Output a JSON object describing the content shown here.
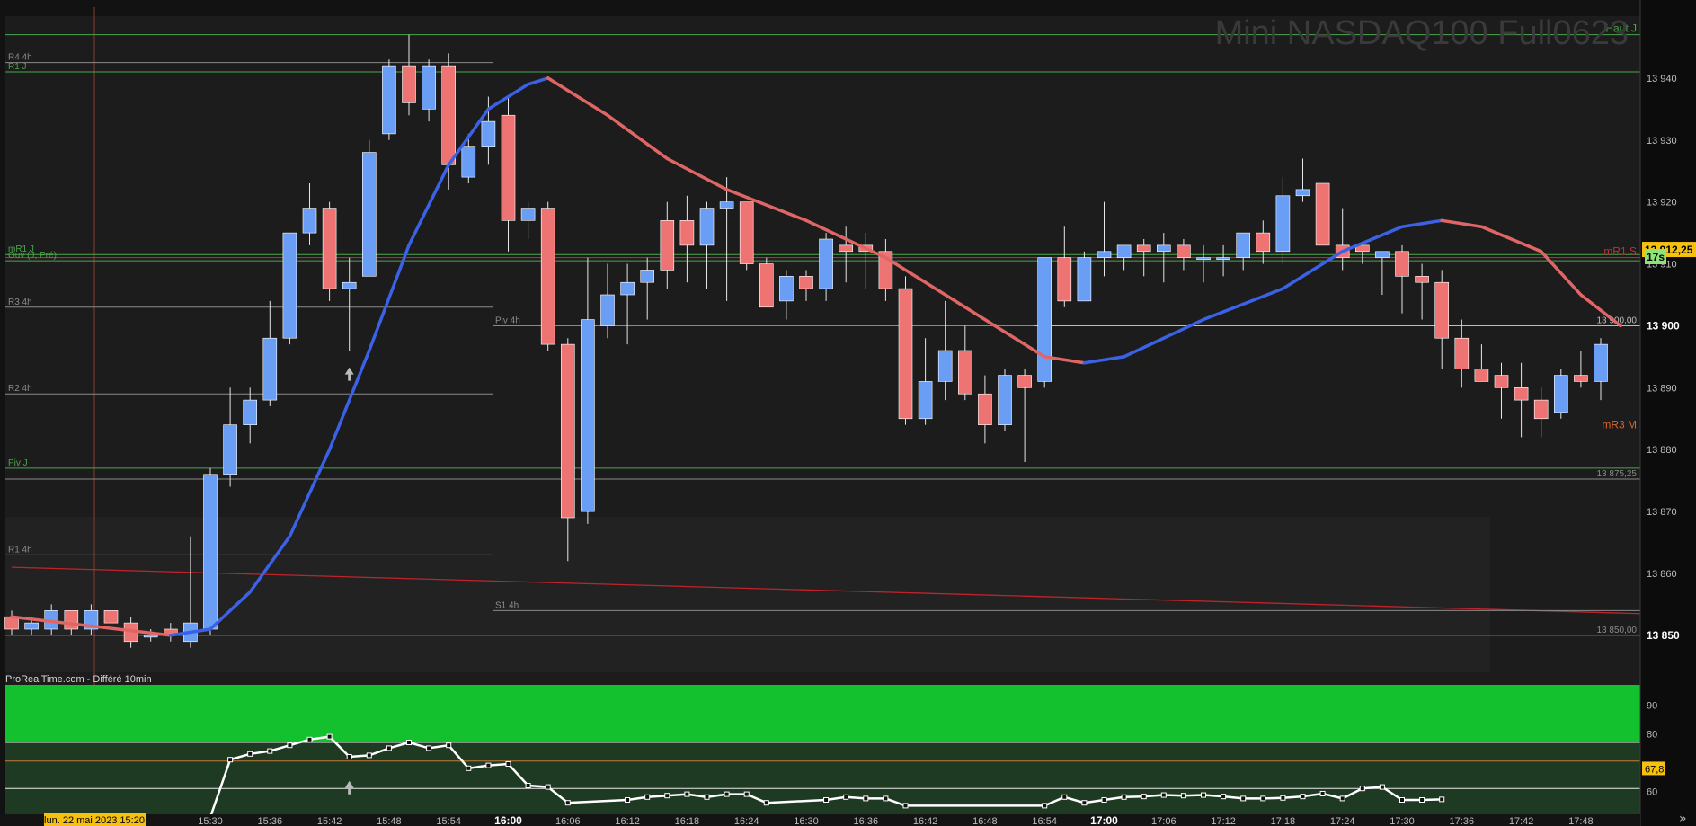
{
  "watermark": "Mini NASDAQ100 Full0623",
  "footer_source": "ProRealTime.com - Différé 10min",
  "date_badge": "lun. 22 mai 2023 15:20",
  "countdown": "17s",
  "nav_arrows": "»",
  "colors": {
    "bull": "#6a9ef5",
    "bear": "#ee7474",
    "ma_up": "#3b62e6",
    "ma_down": "#e06666",
    "osc_zone": "#13c02e",
    "price_tag": "#f5c010",
    "countdown_bg": "#8ee27a"
  },
  "chart_data": {
    "type": "candlestick",
    "y_axis": {
      "ylim": [
        13842,
        13950
      ],
      "ticks": [
        "13 940",
        "13 930",
        "13 920",
        "13 910",
        "13 900",
        "13 890",
        "13 880",
        "13 870",
        "13 860",
        "13 850"
      ],
      "tick_values": [
        13940,
        13930,
        13920,
        13910,
        13900,
        13890,
        13880,
        13870,
        13860,
        13850
      ]
    },
    "x_axis": {
      "ticks": [
        "15:30",
        "15:36",
        "15:42",
        "15:48",
        "15:54",
        "16:00",
        "16:06",
        "16:12",
        "16:18",
        "16:24",
        "16:30",
        "16:36",
        "16:42",
        "16:48",
        "16:54",
        "17:00",
        "17:06",
        "17:12",
        "17:18",
        "17:24",
        "17:30",
        "17:36",
        "17:42",
        "17:48"
      ],
      "tick_bar_index": [
        10,
        13,
        16,
        19,
        22,
        25,
        28,
        31,
        34,
        37,
        40,
        43,
        46,
        49,
        52,
        55,
        58,
        61,
        64,
        67,
        70,
        73,
        76,
        79
      ]
    },
    "last_price": "13 912,25",
    "candles": [
      {
        "o": 13853,
        "h": 13854,
        "l": 13850,
        "c": 13851
      },
      {
        "o": 13851,
        "h": 13853,
        "l": 13850,
        "c": 13852
      },
      {
        "o": 13851,
        "h": 13855,
        "l": 13850,
        "c": 13854
      },
      {
        "o": 13854,
        "h": 13854,
        "l": 13850,
        "c": 13851
      },
      {
        "o": 13851,
        "h": 13855,
        "l": 13850,
        "c": 13854
      },
      {
        "o": 13854,
        "h": 13854,
        "l": 13851,
        "c": 13852
      },
      {
        "o": 13852,
        "h": 13853,
        "l": 13848,
        "c": 13849
      },
      {
        "o": 13850,
        "h": 13851,
        "l": 13849,
        "c": 13850
      },
      {
        "o": 13851,
        "h": 13852,
        "l": 13849,
        "c": 13850
      },
      {
        "o": 13849,
        "h": 13866,
        "l": 13848,
        "c": 13852
      },
      {
        "o": 13851,
        "h": 13877,
        "l": 13850,
        "c": 13876
      },
      {
        "o": 13876,
        "h": 13890,
        "l": 13874,
        "c": 13884
      },
      {
        "o": 13884,
        "h": 13890,
        "l": 13881,
        "c": 13888
      },
      {
        "o": 13888,
        "h": 13904,
        "l": 13887,
        "c": 13898
      },
      {
        "o": 13898,
        "h": 13915,
        "l": 13897,
        "c": 13915
      },
      {
        "o": 13915,
        "h": 13923,
        "l": 13913,
        "c": 13919
      },
      {
        "o": 13919,
        "h": 13920,
        "l": 13904,
        "c": 13906
      },
      {
        "o": 13906,
        "h": 13911,
        "l": 13896,
        "c": 13907
      },
      {
        "o": 13908,
        "h": 13930,
        "l": 13908,
        "c": 13928
      },
      {
        "o": 13931,
        "h": 13943,
        "l": 13930,
        "c": 13942
      },
      {
        "o": 13942,
        "h": 13947,
        "l": 13934,
        "c": 13936
      },
      {
        "o": 13935,
        "h": 13943,
        "l": 13933,
        "c": 13942
      },
      {
        "o": 13942,
        "h": 13944,
        "l": 13922,
        "c": 13926
      },
      {
        "o": 13924,
        "h": 13931,
        "l": 13923,
        "c": 13929
      },
      {
        "o": 13929,
        "h": 13937,
        "l": 13926,
        "c": 13933
      },
      {
        "o": 13934,
        "h": 13937,
        "l": 13912,
        "c": 13917
      },
      {
        "o": 13917,
        "h": 13920,
        "l": 13914,
        "c": 13919
      },
      {
        "o": 13919,
        "h": 13920,
        "l": 13896,
        "c": 13897
      },
      {
        "o": 13897,
        "h": 13898,
        "l": 13862,
        "c": 13869
      },
      {
        "o": 13870,
        "h": 13911,
        "l": 13868,
        "c": 13901
      },
      {
        "o": 13900,
        "h": 13910,
        "l": 13898,
        "c": 13905
      },
      {
        "o": 13905,
        "h": 13910,
        "l": 13897,
        "c": 13907
      },
      {
        "o": 13907,
        "h": 13911,
        "l": 13901,
        "c": 13909
      },
      {
        "o": 13917,
        "h": 13920,
        "l": 13906,
        "c": 13909
      },
      {
        "o": 13917,
        "h": 13921,
        "l": 13907,
        "c": 13913
      },
      {
        "o": 13913,
        "h": 13920,
        "l": 13906,
        "c": 13919
      },
      {
        "o": 13919,
        "h": 13924,
        "l": 13904,
        "c": 13920
      },
      {
        "o": 13920,
        "h": 13920,
        "l": 13909,
        "c": 13910
      },
      {
        "o": 13910,
        "h": 13911,
        "l": 13903,
        "c": 13903
      },
      {
        "o": 13904,
        "h": 13909,
        "l": 13901,
        "c": 13908
      },
      {
        "o": 13908,
        "h": 13909,
        "l": 13904,
        "c": 13906
      },
      {
        "o": 13906,
        "h": 13915,
        "l": 13904,
        "c": 13914
      },
      {
        "o": 13913,
        "h": 13916,
        "l": 13907,
        "c": 13912
      },
      {
        "o": 13913,
        "h": 13915,
        "l": 13906,
        "c": 13912
      },
      {
        "o": 13912,
        "h": 13914,
        "l": 13904,
        "c": 13906
      },
      {
        "o": 13906,
        "h": 13908,
        "l": 13884,
        "c": 13885
      },
      {
        "o": 13885,
        "h": 13898,
        "l": 13884,
        "c": 13891
      },
      {
        "o": 13891,
        "h": 13904,
        "l": 13888,
        "c": 13896
      },
      {
        "o": 13896,
        "h": 13900,
        "l": 13888,
        "c": 13889
      },
      {
        "o": 13889,
        "h": 13892,
        "l": 13881,
        "c": 13884
      },
      {
        "o": 13884,
        "h": 13893,
        "l": 13883,
        "c": 13892
      },
      {
        "o": 13892,
        "h": 13893,
        "l": 13878,
        "c": 13890
      },
      {
        "o": 13891,
        "h": 13911,
        "l": 13890,
        "c": 13911
      },
      {
        "o": 13911,
        "h": 13916,
        "l": 13903,
        "c": 13904
      },
      {
        "o": 13904,
        "h": 13912,
        "l": 13904,
        "c": 13911
      },
      {
        "o": 13911,
        "h": 13920,
        "l": 13908,
        "c": 13912
      },
      {
        "o": 13911,
        "h": 13913,
        "l": 13909,
        "c": 13913
      },
      {
        "o": 13913,
        "h": 13914,
        "l": 13908,
        "c": 13912
      },
      {
        "o": 13912,
        "h": 13915,
        "l": 13907,
        "c": 13913
      },
      {
        "o": 13913,
        "h": 13914,
        "l": 13909,
        "c": 13911
      },
      {
        "o": 13911,
        "h": 13913,
        "l": 13907,
        "c": 13911
      },
      {
        "o": 13911,
        "h": 13913,
        "l": 13908,
        "c": 13911
      },
      {
        "o": 13911,
        "h": 13915,
        "l": 13909,
        "c": 13915
      },
      {
        "o": 13915,
        "h": 13917,
        "l": 13910,
        "c": 13912
      },
      {
        "o": 13912,
        "h": 13924,
        "l": 13910,
        "c": 13921
      },
      {
        "o": 13921,
        "h": 13927,
        "l": 13920,
        "c": 13922
      },
      {
        "o": 13923,
        "h": 13923,
        "l": 13913,
        "c": 13913
      },
      {
        "o": 13913,
        "h": 13919,
        "l": 13909,
        "c": 13911
      },
      {
        "o": 13913,
        "h": 13913,
        "l": 13910,
        "c": 13912
      },
      {
        "o": 13911,
        "h": 13911,
        "l": 13905,
        "c": 13912
      },
      {
        "o": 13912,
        "h": 13913,
        "l": 13902,
        "c": 13908
      },
      {
        "o": 13908,
        "h": 13910,
        "l": 13901,
        "c": 13907
      },
      {
        "o": 13907,
        "h": 13909,
        "l": 13893,
        "c": 13898
      },
      {
        "o": 13898,
        "h": 13901,
        "l": 13890,
        "c": 13893
      },
      {
        "o": 13893,
        "h": 13897,
        "l": 13891,
        "c": 13891
      },
      {
        "o": 13892,
        "h": 13894,
        "l": 13885,
        "c": 13890
      },
      {
        "o": 13890,
        "h": 13894,
        "l": 13882,
        "c": 13888
      },
      {
        "o": 13888,
        "h": 13890,
        "l": 13882,
        "c": 13885
      },
      {
        "o": 13886,
        "h": 13893,
        "l": 13885,
        "c": 13892
      },
      {
        "o": 13892,
        "h": 13896,
        "l": 13890,
        "c": 13891
      },
      {
        "o": 13891,
        "h": 13898,
        "l": 13888,
        "c": 13897
      }
    ],
    "moving_average": [
      {
        "i": 0,
        "v": 13853
      },
      {
        "i": 4,
        "v": 13851.5
      },
      {
        "i": 8,
        "v": 13850
      },
      {
        "i": 10,
        "v": 13851
      },
      {
        "i": 12,
        "v": 13857
      },
      {
        "i": 14,
        "v": 13866
      },
      {
        "i": 16,
        "v": 13880
      },
      {
        "i": 18,
        "v": 13896
      },
      {
        "i": 20,
        "v": 13913
      },
      {
        "i": 22,
        "v": 13926
      },
      {
        "i": 24,
        "v": 13935
      },
      {
        "i": 26,
        "v": 13939
      },
      {
        "i": 27,
        "v": 13940
      },
      {
        "i": 30,
        "v": 13934
      },
      {
        "i": 33,
        "v": 13927
      },
      {
        "i": 36,
        "v": 13922
      },
      {
        "i": 40,
        "v": 13917
      },
      {
        "i": 44,
        "v": 13911
      },
      {
        "i": 48,
        "v": 13903
      },
      {
        "i": 50,
        "v": 13899
      },
      {
        "i": 52,
        "v": 13895
      },
      {
        "i": 54,
        "v": 13894
      },
      {
        "i": 56,
        "v": 13895
      },
      {
        "i": 58,
        "v": 13898
      },
      {
        "i": 60,
        "v": 13901
      },
      {
        "i": 64,
        "v": 13906
      },
      {
        "i": 67,
        "v": 13912
      },
      {
        "i": 70,
        "v": 13916
      },
      {
        "i": 72,
        "v": 13917
      },
      {
        "i": 74,
        "v": 13916
      },
      {
        "i": 77,
        "v": 13912
      },
      {
        "i": 79,
        "v": 13905
      },
      {
        "i": 81,
        "v": 13900
      }
    ],
    "ma_turn_points": [
      {
        "i": 27,
        "v": 13940
      },
      {
        "i": 54,
        "v": 13894
      },
      {
        "i": 72,
        "v": 13917
      }
    ],
    "level_lines": [
      {
        "label": "Haut J",
        "y": 13947,
        "color": "#49a64a",
        "scope": "full",
        "label_side": "right"
      },
      {
        "label": "R4 4h",
        "y": 13942.5,
        "color": "#8a8a8a",
        "scope": "left",
        "label_side": "left"
      },
      {
        "label": "R1 J",
        "y": 13941,
        "color": "#49a64a",
        "scope": "full",
        "label_side": "left"
      },
      {
        "label": "mR1 J",
        "y": 13911.5,
        "color": "#49a64a",
        "scope": "full",
        "label_side": "left"
      },
      {
        "label": "mR1 S",
        "y": 13911,
        "color": "#cc2b3a",
        "scope": "full",
        "label_side": "right"
      },
      {
        "label": "Ouv (J, Pré)",
        "y": 13910.5,
        "color": "#49a64a",
        "scope": "full",
        "label_side": "left"
      },
      {
        "label": "R3 4h",
        "y": 13903,
        "color": "#8a8a8a",
        "scope": "left",
        "label_side": "left"
      },
      {
        "label": "Piv 4h",
        "y": 13900,
        "color": "#8a8a8a",
        "scope": "mid",
        "label_side": "left"
      },
      {
        "label": "13 900,00",
        "y": 13900,
        "color": "#bdbdbd",
        "scope": "right",
        "label_side": "right"
      },
      {
        "label": "R2 4h",
        "y": 13889,
        "color": "#8a8a8a",
        "scope": "left",
        "label_side": "left"
      },
      {
        "label": "mR3 M",
        "y": 13883,
        "color": "#d9652a",
        "scope": "full",
        "label_side": "right"
      },
      {
        "label": "Piv J",
        "y": 13877,
        "color": "#49a64a",
        "scope": "full",
        "label_side": "left"
      },
      {
        "label": "13 875,25",
        "y": 13875.25,
        "color": "#8a8a8a",
        "scope": "full",
        "label_side": "right"
      },
      {
        "label": "R1 4h",
        "y": 13863,
        "color": "#8a8a8a",
        "scope": "left",
        "label_side": "left"
      },
      {
        "label": "S1 4h",
        "y": 13854,
        "color": "#8a8a8a",
        "scope": "mid",
        "label_side": "left"
      },
      {
        "label": "13 850,00",
        "y": 13850,
        "color": "#8a8a8a",
        "scope": "full",
        "label_side": "right"
      }
    ],
    "trend_line": {
      "from": {
        "i": 0,
        "v": 13861
      },
      "to": {
        "i": 82,
        "v": 13853.5
      },
      "color": "#c0242b"
    },
    "markers": [
      {
        "type": "up-arrow",
        "i": 17,
        "v": 13893
      }
    ],
    "oscillator": {
      "axis_ticks": [
        "90",
        "80",
        "60"
      ],
      "axis_values": [
        90,
        80,
        60
      ],
      "ylim": [
        52,
        97
      ],
      "zone_top_value": 77,
      "level_lines": [
        77,
        70.5,
        61
      ],
      "current_value": "67,8",
      "current_level": 67.8,
      "points": [
        {
          "i": 10,
          "v": 51
        },
        {
          "i": 11,
          "v": 71
        },
        {
          "i": 12,
          "v": 73
        },
        {
          "i": 13,
          "v": 74
        },
        {
          "i": 14,
          "v": 76
        },
        {
          "i": 15,
          "v": 78
        },
        {
          "i": 16,
          "v": 79
        },
        {
          "i": 17,
          "v": 72
        },
        {
          "i": 18,
          "v": 72.5
        },
        {
          "i": 19,
          "v": 75
        },
        {
          "i": 20,
          "v": 77
        },
        {
          "i": 21,
          "v": 75
        },
        {
          "i": 22,
          "v": 76
        },
        {
          "i": 23,
          "v": 68
        },
        {
          "i": 24,
          "v": 69
        },
        {
          "i": 25,
          "v": 69.5
        },
        {
          "i": 26,
          "v": 62
        },
        {
          "i": 27,
          "v": 61.5
        },
        {
          "i": 28,
          "v": 56
        },
        {
          "i": 31,
          "v": 57
        },
        {
          "i": 32,
          "v": 58
        },
        {
          "i": 33,
          "v": 58.5
        },
        {
          "i": 34,
          "v": 59
        },
        {
          "i": 35,
          "v": 58
        },
        {
          "i": 36,
          "v": 59
        },
        {
          "i": 37,
          "v": 59
        },
        {
          "i": 38,
          "v": 56
        },
        {
          "i": 41,
          "v": 57
        },
        {
          "i": 42,
          "v": 58
        },
        {
          "i": 43,
          "v": 57.5
        },
        {
          "i": 44,
          "v": 57.5
        },
        {
          "i": 45,
          "v": 55
        },
        {
          "i": 52,
          "v": 55
        },
        {
          "i": 53,
          "v": 58
        },
        {
          "i": 54,
          "v": 56
        },
        {
          "i": 55,
          "v": 57
        },
        {
          "i": 56,
          "v": 58
        },
        {
          "i": 57,
          "v": 58.2
        },
        {
          "i": 58,
          "v": 58.7
        },
        {
          "i": 59,
          "v": 58.5
        },
        {
          "i": 60,
          "v": 58.7
        },
        {
          "i": 61,
          "v": 58.2
        },
        {
          "i": 62,
          "v": 57.5
        },
        {
          "i": 63,
          "v": 57.5
        },
        {
          "i": 64,
          "v": 57.7
        },
        {
          "i": 65,
          "v": 58.2
        },
        {
          "i": 66,
          "v": 59.2
        },
        {
          "i": 67,
          "v": 57.5
        },
        {
          "i": 68,
          "v": 61
        },
        {
          "i": 69,
          "v": 61.5
        },
        {
          "i": 70,
          "v": 57
        },
        {
          "i": 71,
          "v": 57
        },
        {
          "i": 72,
          "v": 57.2
        }
      ],
      "markers": [
        {
          "type": "up-arrow",
          "i": 17,
          "v": 63
        }
      ]
    }
  }
}
